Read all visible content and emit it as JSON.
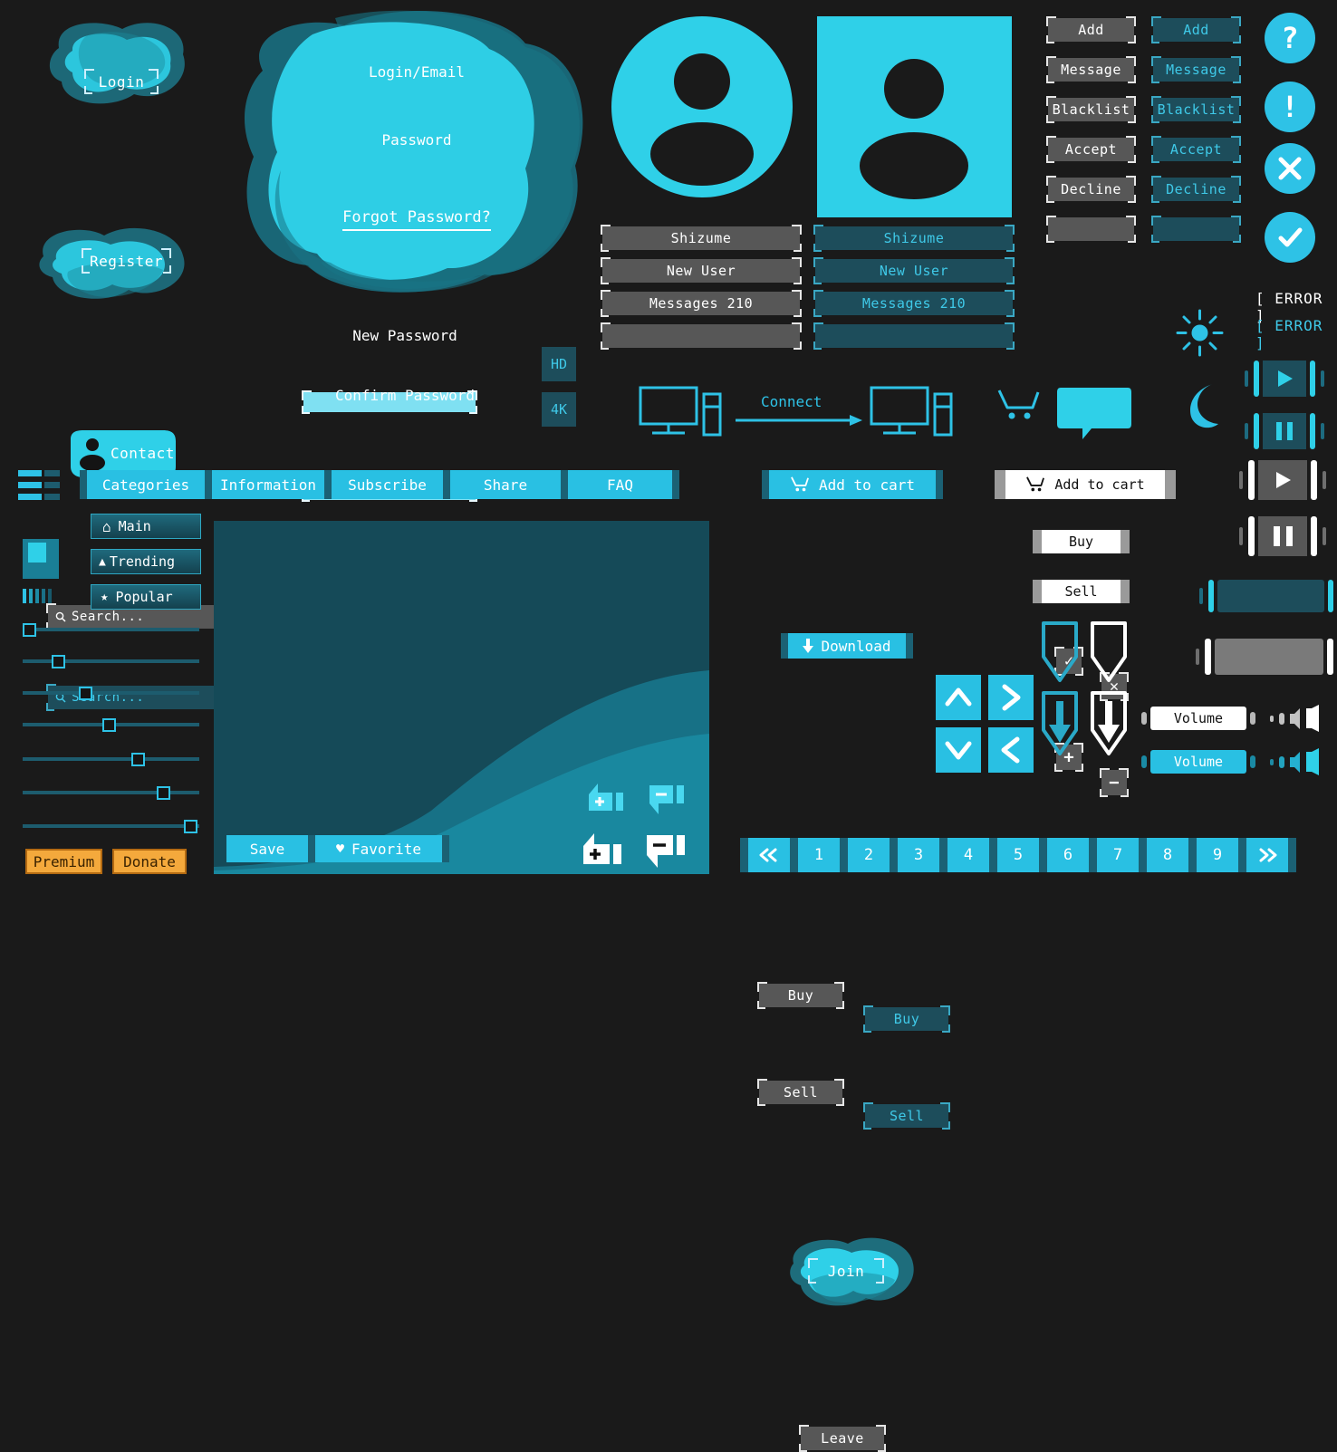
{
  "theme": {
    "bg": "#1a1a1a",
    "cyan": "#29c0e3",
    "cyan_light": "#2ec2e6",
    "teal_dark": "#1d4d5b",
    "teal_panel": "#154a58",
    "grey": "#575757",
    "white": "#ffffff",
    "orange": "#f4a93c"
  },
  "auth": {
    "login_label": "Login",
    "register_label": "Register",
    "contact_label": "Contact",
    "contact_icon": "user-icon",
    "panel": {
      "login_field_label": "Login/Email",
      "login_field_value": "",
      "password_field_label": "Password",
      "password_field_value": "",
      "forgot_label": "Forgot Password?"
    }
  },
  "search": {
    "icon": "search-icon",
    "grey_placeholder": "Search...",
    "teal_placeholder": "Search..."
  },
  "passwords": {
    "new_label": "New Password",
    "new_value": "",
    "confirm_label": "Confirm Password",
    "confirm_value": ""
  },
  "quality": {
    "hd_label": "HD",
    "uhd_label": "4K"
  },
  "profile": {
    "circle_avatar_icon": "user-avatar-circle-icon",
    "square_avatar_icon": "user-avatar-square-icon",
    "rows_grey": [
      "Shizume",
      "New User",
      "Messages 210",
      ""
    ],
    "rows_teal": [
      "Shizume",
      "New User",
      "Messages 210",
      ""
    ]
  },
  "social_actions": {
    "grey": [
      "Add",
      "Message",
      "Blacklist",
      "Accept",
      "Decline",
      ""
    ],
    "teal": [
      "Add",
      "Message",
      "Blacklist",
      "Accept",
      "Decline",
      ""
    ]
  },
  "status_icons": [
    {
      "name": "help-icon",
      "glyph": "?"
    },
    {
      "name": "warning-icon",
      "glyph": "!"
    },
    {
      "name": "close-icon",
      "glyph": "×"
    },
    {
      "name": "check-icon",
      "glyph": "✓"
    }
  ],
  "checkboxes": [
    {
      "name": "checkbox-checked",
      "glyph": "✓"
    },
    {
      "name": "checkbox-cross",
      "glyph": "✕"
    },
    {
      "name": "stepper-plus",
      "glyph": "+"
    },
    {
      "name": "stepper-minus",
      "glyph": "−"
    }
  ],
  "theme_toggle": {
    "day_icon": "sun-icon",
    "night_icon": "moon-icon"
  },
  "errors": {
    "white": "[ ERROR ]",
    "cyan": "[ ERROR ]"
  },
  "connect": {
    "label": "Connect",
    "left_icon": "desktop-computer-icon",
    "right_icon": "desktop-computer-icon",
    "arrow_icon": "arrow-right-icon"
  },
  "cart": {
    "icon": "shopping-cart-icon",
    "bubble_icon": "speech-bubble-icon"
  },
  "nav": {
    "hamburger_icon": "hamburger-menu-icon",
    "tabs": [
      "Categories",
      "Information",
      "Subscribe",
      "Share",
      "FAQ"
    ],
    "menu": [
      {
        "icon": "home-icon",
        "glyph": "⌂",
        "label": "Main"
      },
      {
        "icon": "trending-up-icon",
        "glyph": "▲",
        "label": "Trending"
      },
      {
        "icon": "star-icon",
        "glyph": "★",
        "label": "Popular"
      }
    ],
    "image_placeholder_icon": "image-placeholder-icon",
    "equalizer_icon": "equalizer-icon"
  },
  "sliders": {
    "values": [
      2,
      17,
      32,
      47,
      62,
      77,
      92
    ]
  },
  "footer_buttons": {
    "premium": "Premium",
    "donate": "Donate"
  },
  "preview": {
    "save_label": "Save",
    "favorite_label": "Favorite",
    "favorite_icon": "heart-icon",
    "vote_icons": [
      {
        "name": "thumbs-up-cyan-icon",
        "glyph": "+"
      },
      {
        "name": "thumbs-down-cyan-icon",
        "glyph": "−"
      },
      {
        "name": "thumbs-up-white-icon",
        "glyph": "+"
      },
      {
        "name": "thumbs-down-white-icon",
        "glyph": "−"
      }
    ]
  },
  "commerce": {
    "add_to_cart_cyan": "Add to cart",
    "add_to_cart_white": "Add to cart",
    "buy_grey": "Buy",
    "buy_teal": "Buy",
    "buy_white": "Buy",
    "sell_grey": "Sell",
    "sell_teal": "Sell",
    "sell_white": "Sell",
    "download": "Download",
    "download_icon": "download-arrow-icon",
    "join": "Join",
    "leave": "Leave"
  },
  "dpad": [
    {
      "name": "dpad-up",
      "glyph": "∧"
    },
    {
      "name": "dpad-right",
      "glyph": ">"
    },
    {
      "name": "dpad-down",
      "glyph": "∨"
    },
    {
      "name": "dpad-left",
      "glyph": "<"
    }
  ],
  "download_arrows": [
    {
      "name": "download-outline-cyan-icon"
    },
    {
      "name": "download-outline-white-icon"
    },
    {
      "name": "download-filled-cyan-icon"
    },
    {
      "name": "download-filled-white-icon"
    }
  ],
  "media": {
    "play_teal": "play-icon",
    "pause_teal": "pause-icon",
    "play_grey": "play-icon",
    "pause_grey": "pause-icon",
    "bar_teal": "progress-bar",
    "bar_grey": "progress-bar"
  },
  "volume": {
    "white_label": "Volume",
    "cyan_label": "Volume",
    "speaker_icon": "speaker-icon"
  },
  "pagination": {
    "prev_icon": "chevron-double-left-icon",
    "next_icon": "chevron-double-right-icon",
    "pages": [
      "1",
      "2",
      "3",
      "4",
      "5",
      "6",
      "7",
      "8",
      "9"
    ]
  }
}
